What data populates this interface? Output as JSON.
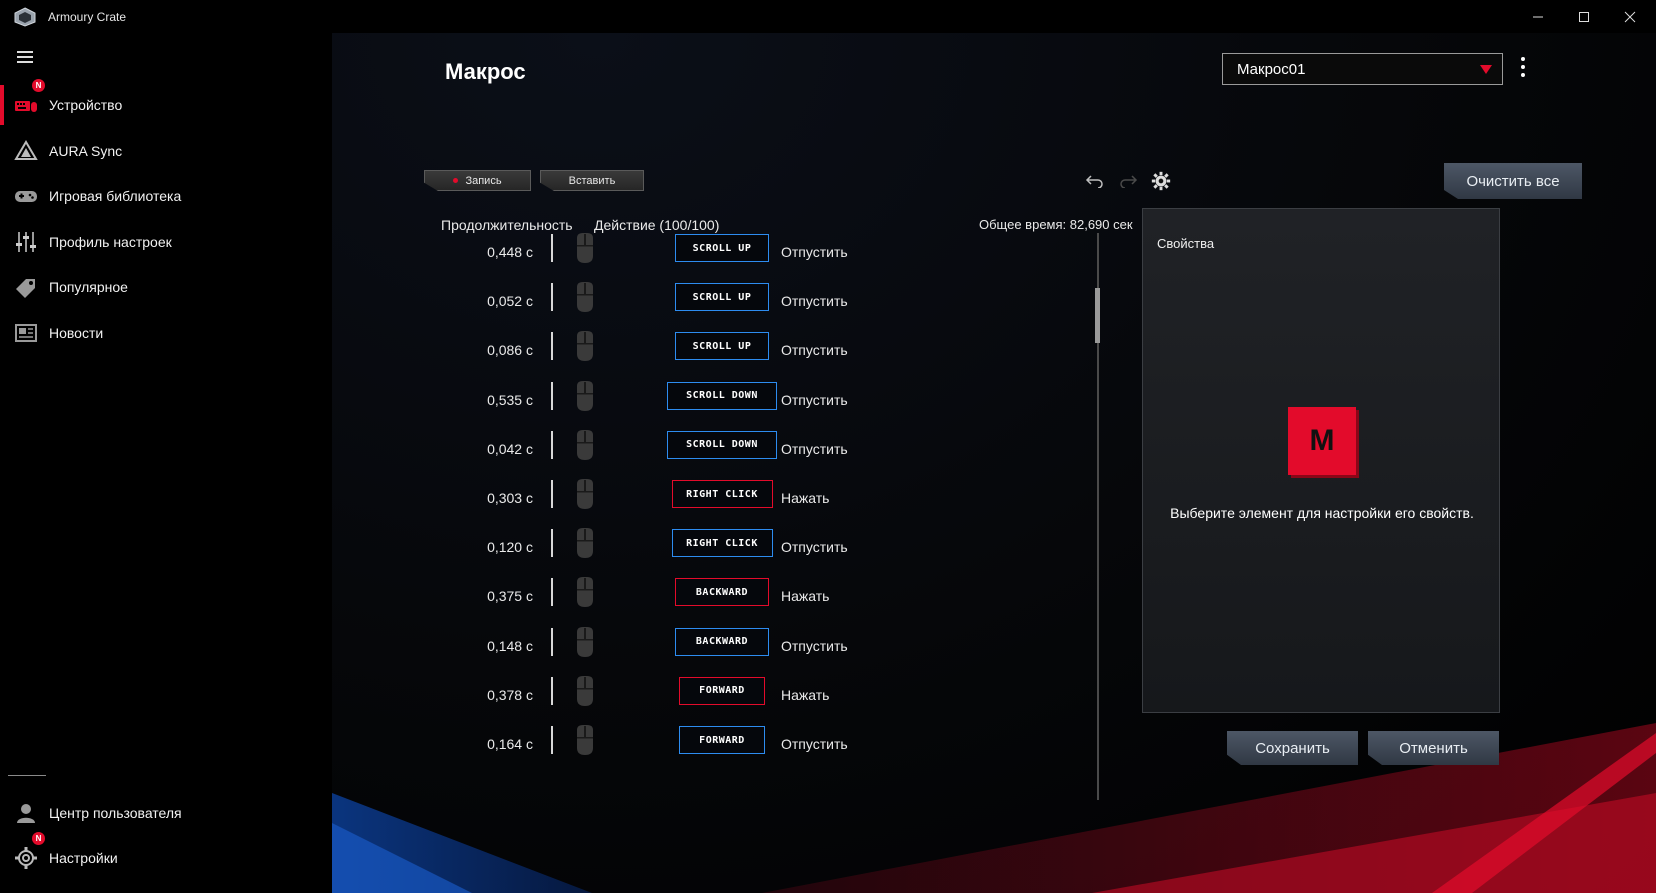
{
  "app": {
    "title": "Armoury Crate"
  },
  "sidebar": {
    "items": [
      {
        "label": "Устройство",
        "icon": "keyboard-mouse-icon",
        "badge": "N",
        "active": true
      },
      {
        "label": "AURA Sync",
        "icon": "aura-triangle-icon"
      },
      {
        "label": "Игровая библиотека",
        "icon": "gamepad-icon"
      },
      {
        "label": "Профиль настроек",
        "icon": "sliders-icon"
      },
      {
        "label": "Популярное",
        "icon": "tag-icon"
      },
      {
        "label": "Новости",
        "icon": "news-icon"
      }
    ],
    "bottom": [
      {
        "label": "Центр пользователя",
        "icon": "user-icon"
      },
      {
        "label": "Настройки",
        "icon": "gear-icon",
        "badge": "N"
      }
    ]
  },
  "main": {
    "title": "Макрос",
    "macro_select": {
      "value": "Макрос01"
    },
    "toolbar": {
      "record_label": "Запись",
      "insert_label": "Вставить",
      "clear_label": "Очистить все"
    },
    "columns": {
      "duration": "Продолжительность",
      "action": "Действие (100/100)",
      "total_time": "Общее время: 82,690 сек"
    },
    "rows": [
      {
        "duration": "0,448 с",
        "key": "SCROLL UP",
        "type": "release",
        "action": "Отпустить"
      },
      {
        "duration": "0,052 с",
        "key": "SCROLL UP",
        "type": "release",
        "action": "Отпустить"
      },
      {
        "duration": "0,086 с",
        "key": "SCROLL UP",
        "type": "release",
        "action": "Отпустить"
      },
      {
        "duration": "0,535 с",
        "key": "SCROLL DOWN",
        "type": "release",
        "action": "Отпустить"
      },
      {
        "duration": "0,042 с",
        "key": "SCROLL DOWN",
        "type": "release",
        "action": "Отпустить"
      },
      {
        "duration": "0,303 с",
        "key": "RIGHT CLICK",
        "type": "press",
        "action": "Нажать"
      },
      {
        "duration": "0,120 с",
        "key": "RIGHT CLICK",
        "type": "release",
        "action": "Отпустить"
      },
      {
        "duration": "0,375 с",
        "key": "BACKWARD",
        "type": "press",
        "action": "Нажать"
      },
      {
        "duration": "0,148 с",
        "key": "BACKWARD",
        "type": "release",
        "action": "Отпустить"
      },
      {
        "duration": "0,378 с",
        "key": "FORWARD",
        "type": "press",
        "action": "Нажать"
      },
      {
        "duration": "0,164 с",
        "key": "FORWARD",
        "type": "release",
        "action": "Отпустить"
      }
    ],
    "properties": {
      "title": "Свойства",
      "key_letter": "M",
      "hint": "Выберите элемент для настройки его свойств."
    },
    "footer": {
      "save_label": "Сохранить",
      "cancel_label": "Отменить"
    }
  },
  "colors": {
    "accent_red": "#e30b2b",
    "release_blue": "#2d8cf0"
  }
}
